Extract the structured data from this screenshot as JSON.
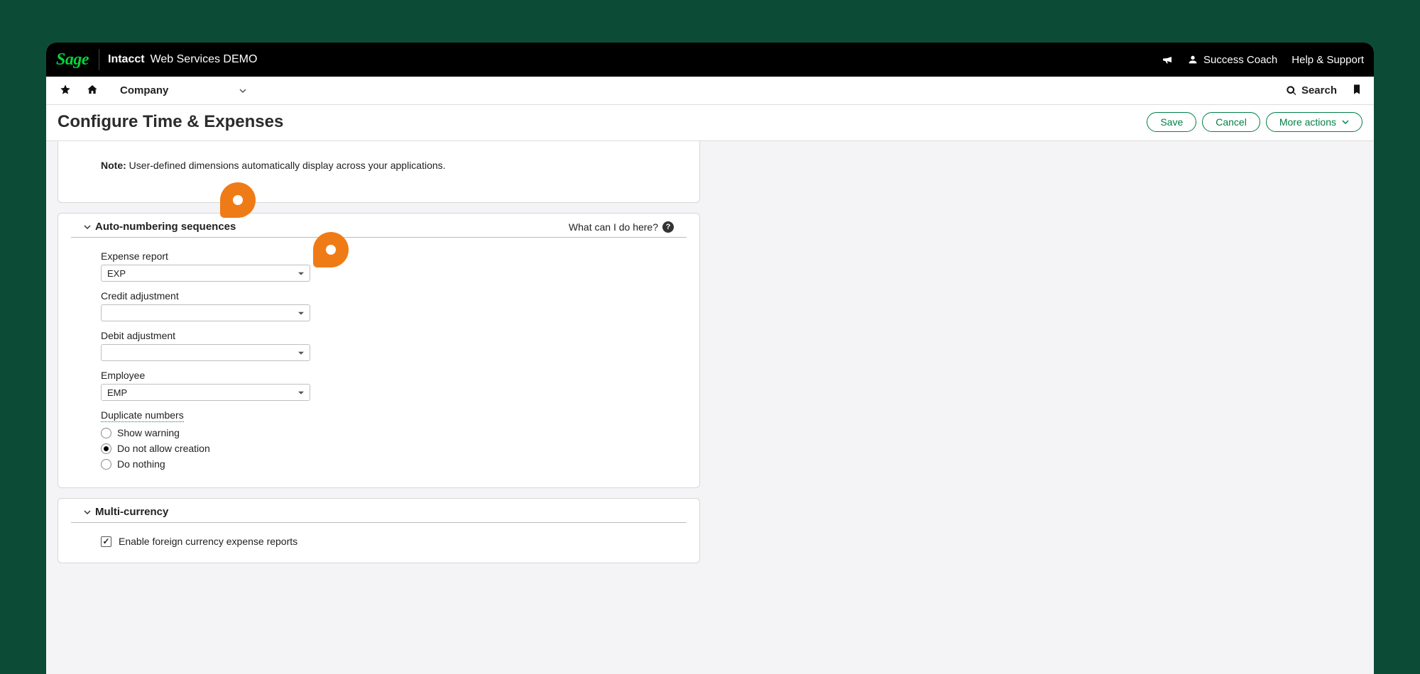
{
  "brand": {
    "logo_text": "Sage",
    "product": "Intacct",
    "environment": "Web Services DEMO"
  },
  "topbar": {
    "user_label": "Success Coach",
    "help_label": "Help & Support"
  },
  "navbar": {
    "module_label": "Company",
    "search_label": "Search"
  },
  "page": {
    "title": "Configure Time & Expenses",
    "actions": {
      "save": "Save",
      "cancel": "Cancel",
      "more": "More actions"
    }
  },
  "note": {
    "prefix": "Note:",
    "text": "User-defined dimensions automatically display across your applications."
  },
  "sections": {
    "auto_numbering": {
      "title": "Auto-numbering sequences",
      "help_text": "What can I do here?",
      "fields": {
        "expense_report": {
          "label": "Expense report",
          "value": "EXP"
        },
        "credit_adjustment": {
          "label": "Credit adjustment",
          "value": ""
        },
        "debit_adjustment": {
          "label": "Debit adjustment",
          "value": ""
        },
        "employee": {
          "label": "Employee",
          "value": "EMP"
        }
      },
      "duplicate": {
        "label": "Duplicate numbers",
        "options": {
          "show_warning": "Show warning",
          "do_not_allow": "Do not allow creation",
          "do_nothing": "Do nothing"
        },
        "selected": "do_not_allow"
      }
    },
    "multi_currency": {
      "title": "Multi-currency",
      "enable_foreign_label": "Enable foreign currency expense reports",
      "enable_foreign_checked": true
    }
  }
}
